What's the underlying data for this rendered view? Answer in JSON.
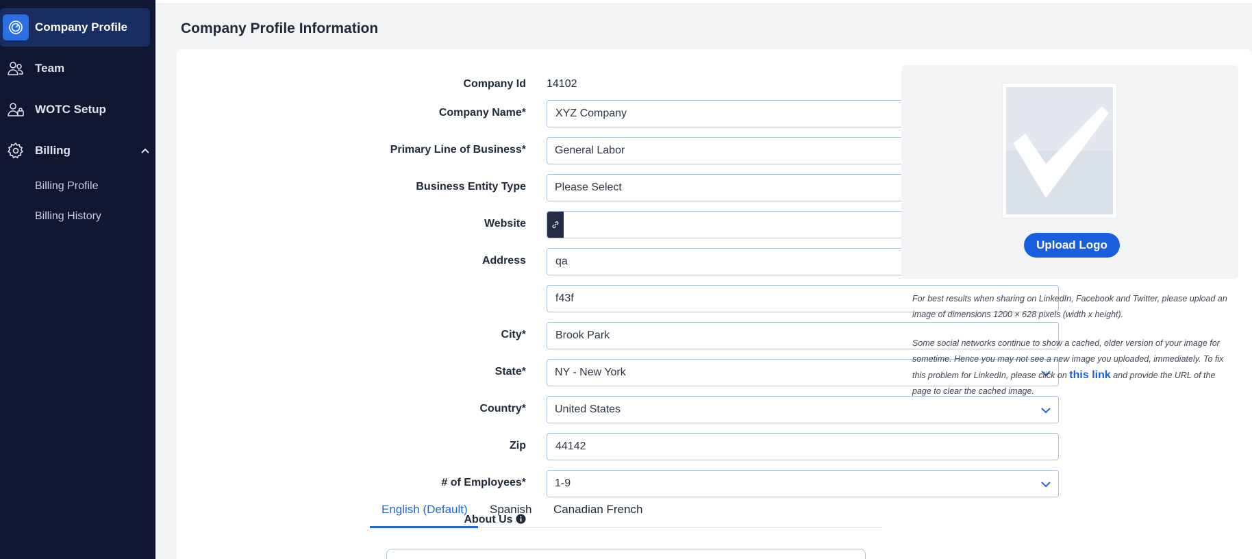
{
  "sidebar": {
    "items": [
      {
        "label": "Company Profile",
        "icon": "gauge-icon",
        "active": true
      },
      {
        "label": "Team",
        "icon": "users-icon"
      },
      {
        "label": "WOTC Setup",
        "icon": "users-lock-icon"
      },
      {
        "label": "Billing",
        "icon": "gear-icon",
        "expanded": true
      }
    ],
    "billing_sub": [
      "Billing Profile",
      "Billing History"
    ]
  },
  "page": {
    "title": "Company Profile Information"
  },
  "form": {
    "company_id": {
      "label": "Company Id",
      "value": "14102"
    },
    "company_name": {
      "label": "Company Name*",
      "value": "XYZ Company"
    },
    "line_of_business": {
      "label": "Primary Line of Business*",
      "value": "General Labor"
    },
    "entity_type": {
      "label": "Business Entity Type",
      "value": "Please Select"
    },
    "website": {
      "label": "Website",
      "value": ""
    },
    "address": {
      "label": "Address",
      "line1": "qa",
      "line2": "f43f"
    },
    "city": {
      "label": "City*",
      "value": "Brook Park"
    },
    "state": {
      "label": "State*",
      "value": "NY - New York"
    },
    "country": {
      "label": "Country*",
      "value": "United States"
    },
    "zip": {
      "label": "Zip",
      "value": "44142"
    },
    "employees": {
      "label": "# of Employees*",
      "value": "1-9"
    },
    "about_us": {
      "label": "About Us"
    }
  },
  "tabs": [
    "English (Default)",
    "Spanish",
    "Canadian French"
  ],
  "logo": {
    "upload_label": "Upload Logo",
    "note1": "For best results when sharing on LinkedIn, Facebook and Twitter, please upload an image of dimensions 1200 × 628 pixels (width x height).",
    "note2_before": "Some social networks continue to show a cached, older version of your image for sometime. Hence you may not see a new image you uploaded, immediately. To fix this problem for LinkedIn, please click on",
    "note2_link": "this link",
    "note2_after": "and provide the URL of the page to clear the cached image."
  },
  "colors": {
    "sidebar_bg": "#111731",
    "accent": "#1a5ee0",
    "active_nav": "#1a2d63"
  }
}
